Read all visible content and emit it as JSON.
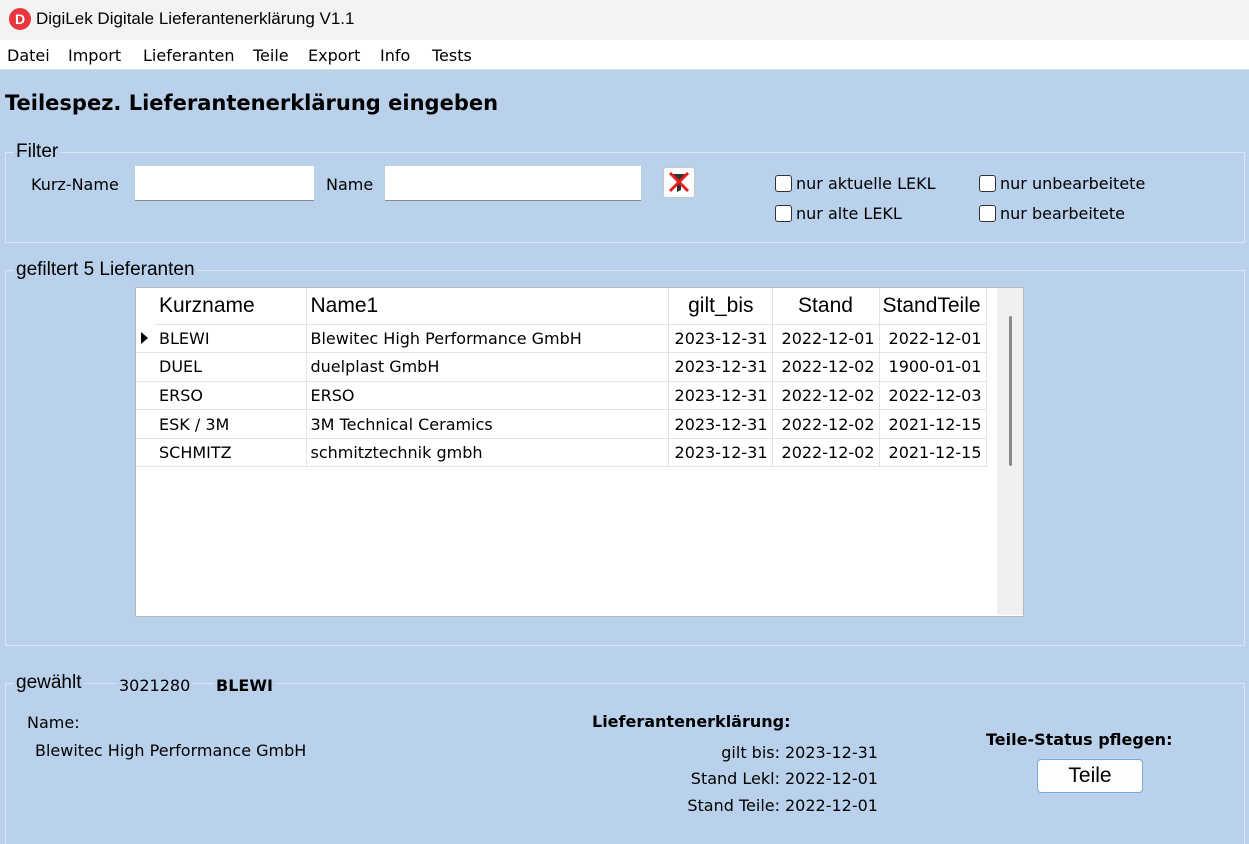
{
  "window": {
    "title": "DigiLek Digitale Lieferantenerklärung V1.1",
    "icon": "app-logo-icon",
    "icon_letter": "D"
  },
  "menu": [
    "Datei",
    "Import",
    "Lieferanten",
    "Teile",
    "Export",
    "Info",
    "Tests"
  ],
  "page_title": "Teilespez. Lieferantenerklärung eingeben",
  "filter": {
    "group_label": "Filter",
    "kurzname_label": "Kurz-Name",
    "kurzname_value": "",
    "name_label": "Name",
    "name_value": "",
    "clear_icon": "clear-filter-icon",
    "checkboxes": [
      {
        "label": "nur aktuelle LEKL",
        "checked": false
      },
      {
        "label": "nur alte LEKL",
        "checked": false
      },
      {
        "label": "nur unbearbeitete",
        "checked": false
      },
      {
        "label": "nur bearbeitete",
        "checked": false
      }
    ]
  },
  "list": {
    "group_label": "gefiltert 5 Lieferanten",
    "columns": [
      "Kurzname",
      "Name1",
      "gilt_bis",
      "Stand",
      "StandTeile"
    ],
    "rows": [
      [
        "BLEWI",
        "Blewitec High Performance GmbH",
        "2023-12-31",
        "2022-12-01",
        "2022-12-01"
      ],
      [
        "DUEL",
        "duelplast GmbH",
        "2023-12-31",
        "2022-12-02",
        "1900-01-01"
      ],
      [
        "ERSO",
        "ERSO",
        "2023-12-31",
        "2022-12-02",
        "2022-12-03"
      ],
      [
        "ESK / 3M",
        "3M Technical Ceramics",
        "2023-12-31",
        "2022-12-02",
        "2021-12-15"
      ],
      [
        "SCHMITZ",
        "schmitztechnik gmbh",
        "2023-12-31",
        "2022-12-02",
        "2021-12-15"
      ]
    ],
    "selected_row": 0
  },
  "selection": {
    "group_label": "gewählt",
    "id": "3021280",
    "kurzname": "BLEWI",
    "name_label": "Name:",
    "name_value": "Blewitec High Performance GmbH",
    "lekl_heading": "Lieferantenerklärung:",
    "gilt_bis_label": "gilt bis:",
    "gilt_bis_value": "2023-12-31",
    "stand_lekl_label": "Stand Lekl:",
    "stand_lekl_value": "2022-12-01",
    "stand_teile_label": "Stand Teile:",
    "stand_teile_value": "2022-12-01",
    "teile_status_label": "Teile-Status pflegen:",
    "teile_button": "Teile"
  }
}
